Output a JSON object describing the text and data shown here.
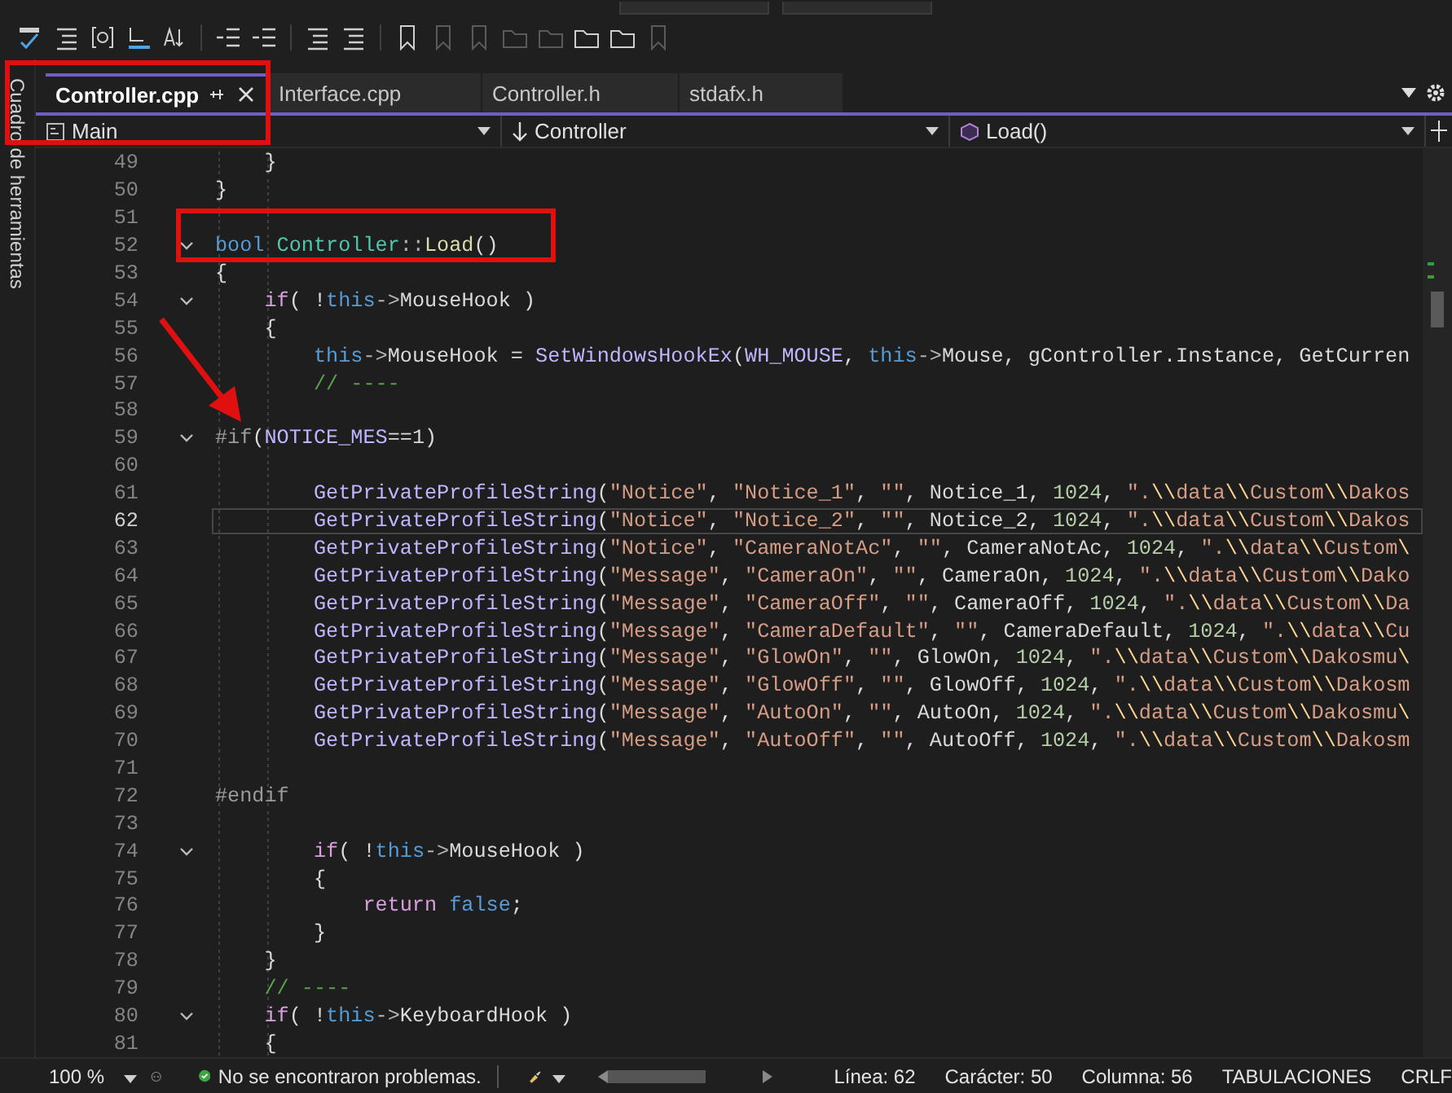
{
  "sidebar": {
    "label": "Cuadro de herramientas"
  },
  "tabs": [
    {
      "label": "Controller.cpp",
      "selected": true
    },
    {
      "label": "Interface.cpp",
      "selected": false
    },
    {
      "label": "Controller.h",
      "selected": false
    },
    {
      "label": "stdafx.h",
      "selected": false
    }
  ],
  "nav": {
    "project": "Main",
    "scope": "Controller",
    "member": "Load()"
  },
  "lines": [
    {
      "number": "49",
      "fold": false,
      "current": false,
      "tokens": [
        {
          "kind": "plain",
          "text": "    }"
        }
      ]
    },
    {
      "number": "50",
      "fold": false,
      "current": false,
      "tokens": [
        {
          "kind": "plain",
          "text": "}"
        }
      ]
    },
    {
      "number": "51",
      "fold": false,
      "current": false
    },
    {
      "number": "52",
      "fold": true,
      "current": false,
      "tokens": [
        {
          "kind": "kw",
          "text": "bool "
        },
        {
          "kind": "type",
          "text": "Controller"
        },
        {
          "kind": "punct",
          "text": "::"
        },
        {
          "kind": "fn",
          "text": "Load"
        },
        {
          "kind": "plain",
          "text": "()"
        }
      ]
    },
    {
      "number": "53",
      "fold": false,
      "current": false,
      "tokens": [
        {
          "kind": "plain",
          "text": "{"
        }
      ]
    },
    {
      "number": "54",
      "fold": true,
      "current": false,
      "tokens": [
        {
          "kind": "ctl",
          "text": "    if"
        },
        {
          "kind": "plain",
          "text": "( !"
        },
        {
          "kind": "kw",
          "text": "this"
        },
        {
          "kind": "punct",
          "text": "->"
        },
        {
          "kind": "plain",
          "text": "MouseHook )"
        }
      ]
    },
    {
      "number": "55",
      "fold": false,
      "current": false,
      "tokens": [
        {
          "kind": "plain",
          "text": "    {"
        }
      ]
    },
    {
      "number": "56",
      "fold": false,
      "current": false,
      "tokens": [
        {
          "kind": "kw",
          "text": "        this"
        },
        {
          "kind": "punct",
          "text": "->"
        },
        {
          "kind": "plain",
          "text": "MouseHook = "
        },
        {
          "kind": "macro",
          "text": "SetWindowsHookEx"
        },
        {
          "kind": "plain",
          "text": "("
        },
        {
          "kind": "macro",
          "text": "WH_MOUSE"
        },
        {
          "kind": "plain",
          "text": ", "
        },
        {
          "kind": "kw",
          "text": "this"
        },
        {
          "kind": "punct",
          "text": "->"
        },
        {
          "kind": "plain",
          "text": "Mouse, gController.Instance, GetCurren"
        }
      ]
    },
    {
      "number": "57",
      "fold": false,
      "current": false,
      "tokens": [
        {
          "kind": "cmt",
          "text": "        // ----"
        }
      ]
    },
    {
      "number": "58",
      "fold": false,
      "current": false
    },
    {
      "number": "59",
      "fold": true,
      "current": false,
      "tokens": [
        {
          "kind": "pre",
          "text": "#if"
        },
        {
          "kind": "plain",
          "text": "("
        },
        {
          "kind": "macro",
          "text": "NOTICE_MES"
        },
        {
          "kind": "plain",
          "text": "==1)"
        }
      ]
    },
    {
      "number": "60",
      "fold": false,
      "current": false
    },
    {
      "number": "61",
      "fold": false,
      "current": false,
      "tokens": [
        {
          "kind": "macro",
          "text": "        GetPrivateProfileString"
        },
        {
          "kind": "plain",
          "text": "("
        },
        {
          "kind": "str",
          "text": "\"Notice\""
        },
        {
          "kind": "plain",
          "text": ", "
        },
        {
          "kind": "str",
          "text": "\"Notice_1\""
        },
        {
          "kind": "plain",
          "text": ", "
        },
        {
          "kind": "str",
          "text": "\"\""
        },
        {
          "kind": "plain",
          "text": ", Notice_1, "
        },
        {
          "kind": "num",
          "text": "1024"
        },
        {
          "kind": "plain",
          "text": ", "
        },
        {
          "kind": "str",
          "text": "\"."
        },
        {
          "kind": "esc",
          "text": "\\\\"
        },
        {
          "kind": "str",
          "text": "data"
        },
        {
          "kind": "esc",
          "text": "\\\\"
        },
        {
          "kind": "str",
          "text": "Custom"
        },
        {
          "kind": "esc",
          "text": "\\\\"
        },
        {
          "kind": "str",
          "text": "Dakos"
        }
      ]
    },
    {
      "number": "62",
      "fold": false,
      "current": true,
      "tokens": [
        {
          "kind": "macro",
          "text": "        GetPrivateProfileString"
        },
        {
          "kind": "plain",
          "text": "("
        },
        {
          "kind": "str",
          "text": "\"Notice\""
        },
        {
          "kind": "plain",
          "text": ", "
        },
        {
          "kind": "str",
          "text": "\"Notice_2\""
        },
        {
          "kind": "plain",
          "text": ", "
        },
        {
          "kind": "str",
          "text": "\"\""
        },
        {
          "kind": "plain",
          "text": ", Notice_2, "
        },
        {
          "kind": "num",
          "text": "1024"
        },
        {
          "kind": "plain",
          "text": ", "
        },
        {
          "kind": "str",
          "text": "\"."
        },
        {
          "kind": "esc",
          "text": "\\\\"
        },
        {
          "kind": "str",
          "text": "data"
        },
        {
          "kind": "esc",
          "text": "\\\\"
        },
        {
          "kind": "str",
          "text": "Custom"
        },
        {
          "kind": "esc",
          "text": "\\\\"
        },
        {
          "kind": "str",
          "text": "Dakos"
        }
      ]
    },
    {
      "number": "63",
      "fold": false,
      "current": false,
      "tokens": [
        {
          "kind": "macro",
          "text": "        GetPrivateProfileString"
        },
        {
          "kind": "plain",
          "text": "("
        },
        {
          "kind": "str",
          "text": "\"Notice\""
        },
        {
          "kind": "plain",
          "text": ", "
        },
        {
          "kind": "str",
          "text": "\"CameraNotAc\""
        },
        {
          "kind": "plain",
          "text": ", "
        },
        {
          "kind": "str",
          "text": "\"\""
        },
        {
          "kind": "plain",
          "text": ", CameraNotAc, "
        },
        {
          "kind": "num",
          "text": "1024"
        },
        {
          "kind": "plain",
          "text": ", "
        },
        {
          "kind": "str",
          "text": "\"."
        },
        {
          "kind": "esc",
          "text": "\\\\"
        },
        {
          "kind": "str",
          "text": "data"
        },
        {
          "kind": "esc",
          "text": "\\\\"
        },
        {
          "kind": "str",
          "text": "Custom"
        },
        {
          "kind": "esc",
          "text": "\\"
        }
      ]
    },
    {
      "number": "64",
      "fold": false,
      "current": false,
      "tokens": [
        {
          "kind": "macro",
          "text": "        GetPrivateProfileString"
        },
        {
          "kind": "plain",
          "text": "("
        },
        {
          "kind": "str",
          "text": "\"Message\""
        },
        {
          "kind": "plain",
          "text": ", "
        },
        {
          "kind": "str",
          "text": "\"CameraOn\""
        },
        {
          "kind": "plain",
          "text": ", "
        },
        {
          "kind": "str",
          "text": "\"\""
        },
        {
          "kind": "plain",
          "text": ", CameraOn, "
        },
        {
          "kind": "num",
          "text": "1024"
        },
        {
          "kind": "plain",
          "text": ", "
        },
        {
          "kind": "str",
          "text": "\"."
        },
        {
          "kind": "esc",
          "text": "\\\\"
        },
        {
          "kind": "str",
          "text": "data"
        },
        {
          "kind": "esc",
          "text": "\\\\"
        },
        {
          "kind": "str",
          "text": "Custom"
        },
        {
          "kind": "esc",
          "text": "\\\\"
        },
        {
          "kind": "str",
          "text": "Dako"
        }
      ]
    },
    {
      "number": "65",
      "fold": false,
      "current": false,
      "tokens": [
        {
          "kind": "macro",
          "text": "        GetPrivateProfileString"
        },
        {
          "kind": "plain",
          "text": "("
        },
        {
          "kind": "str",
          "text": "\"Message\""
        },
        {
          "kind": "plain",
          "text": ", "
        },
        {
          "kind": "str",
          "text": "\"CameraOff\""
        },
        {
          "kind": "plain",
          "text": ", "
        },
        {
          "kind": "str",
          "text": "\"\""
        },
        {
          "kind": "plain",
          "text": ", CameraOff, "
        },
        {
          "kind": "num",
          "text": "1024"
        },
        {
          "kind": "plain",
          "text": ", "
        },
        {
          "kind": "str",
          "text": "\"."
        },
        {
          "kind": "esc",
          "text": "\\\\"
        },
        {
          "kind": "str",
          "text": "data"
        },
        {
          "kind": "esc",
          "text": "\\\\"
        },
        {
          "kind": "str",
          "text": "Custom"
        },
        {
          "kind": "esc",
          "text": "\\\\"
        },
        {
          "kind": "str",
          "text": "Da"
        }
      ]
    },
    {
      "number": "66",
      "fold": false,
      "current": false,
      "tokens": [
        {
          "kind": "macro",
          "text": "        GetPrivateProfileString"
        },
        {
          "kind": "plain",
          "text": "("
        },
        {
          "kind": "str",
          "text": "\"Message\""
        },
        {
          "kind": "plain",
          "text": ", "
        },
        {
          "kind": "str",
          "text": "\"CameraDefault\""
        },
        {
          "kind": "plain",
          "text": ", "
        },
        {
          "kind": "str",
          "text": "\"\""
        },
        {
          "kind": "plain",
          "text": ", CameraDefault, "
        },
        {
          "kind": "num",
          "text": "1024"
        },
        {
          "kind": "plain",
          "text": ", "
        },
        {
          "kind": "str",
          "text": "\"."
        },
        {
          "kind": "esc",
          "text": "\\\\"
        },
        {
          "kind": "str",
          "text": "data"
        },
        {
          "kind": "esc",
          "text": "\\\\"
        },
        {
          "kind": "str",
          "text": "Cu"
        }
      ]
    },
    {
      "number": "67",
      "fold": false,
      "current": false,
      "tokens": [
        {
          "kind": "macro",
          "text": "        GetPrivateProfileString"
        },
        {
          "kind": "plain",
          "text": "("
        },
        {
          "kind": "str",
          "text": "\"Message\""
        },
        {
          "kind": "plain",
          "text": ", "
        },
        {
          "kind": "str",
          "text": "\"GlowOn\""
        },
        {
          "kind": "plain",
          "text": ", "
        },
        {
          "kind": "str",
          "text": "\"\""
        },
        {
          "kind": "plain",
          "text": ", GlowOn, "
        },
        {
          "kind": "num",
          "text": "1024"
        },
        {
          "kind": "plain",
          "text": ", "
        },
        {
          "kind": "str",
          "text": "\"."
        },
        {
          "kind": "esc",
          "text": "\\\\"
        },
        {
          "kind": "str",
          "text": "data"
        },
        {
          "kind": "esc",
          "text": "\\\\"
        },
        {
          "kind": "str",
          "text": "Custom"
        },
        {
          "kind": "esc",
          "text": "\\\\"
        },
        {
          "kind": "str",
          "text": "Dakosmu"
        },
        {
          "kind": "esc",
          "text": "\\"
        }
      ]
    },
    {
      "number": "68",
      "fold": false,
      "current": false,
      "tokens": [
        {
          "kind": "macro",
          "text": "        GetPrivateProfileString"
        },
        {
          "kind": "plain",
          "text": "("
        },
        {
          "kind": "str",
          "text": "\"Message\""
        },
        {
          "kind": "plain",
          "text": ", "
        },
        {
          "kind": "str",
          "text": "\"GlowOff\""
        },
        {
          "kind": "plain",
          "text": ", "
        },
        {
          "kind": "str",
          "text": "\"\""
        },
        {
          "kind": "plain",
          "text": ", GlowOff, "
        },
        {
          "kind": "num",
          "text": "1024"
        },
        {
          "kind": "plain",
          "text": ", "
        },
        {
          "kind": "str",
          "text": "\"."
        },
        {
          "kind": "esc",
          "text": "\\\\"
        },
        {
          "kind": "str",
          "text": "data"
        },
        {
          "kind": "esc",
          "text": "\\\\"
        },
        {
          "kind": "str",
          "text": "Custom"
        },
        {
          "kind": "esc",
          "text": "\\\\"
        },
        {
          "kind": "str",
          "text": "Dakosm"
        }
      ]
    },
    {
      "number": "69",
      "fold": false,
      "current": false,
      "tokens": [
        {
          "kind": "macro",
          "text": "        GetPrivateProfileString"
        },
        {
          "kind": "plain",
          "text": "("
        },
        {
          "kind": "str",
          "text": "\"Message\""
        },
        {
          "kind": "plain",
          "text": ", "
        },
        {
          "kind": "str",
          "text": "\"AutoOn\""
        },
        {
          "kind": "plain",
          "text": ", "
        },
        {
          "kind": "str",
          "text": "\"\""
        },
        {
          "kind": "plain",
          "text": ", AutoOn, "
        },
        {
          "kind": "num",
          "text": "1024"
        },
        {
          "kind": "plain",
          "text": ", "
        },
        {
          "kind": "str",
          "text": "\"."
        },
        {
          "kind": "esc",
          "text": "\\\\"
        },
        {
          "kind": "str",
          "text": "data"
        },
        {
          "kind": "esc",
          "text": "\\\\"
        },
        {
          "kind": "str",
          "text": "Custom"
        },
        {
          "kind": "esc",
          "text": "\\\\"
        },
        {
          "kind": "str",
          "text": "Dakosmu"
        },
        {
          "kind": "esc",
          "text": "\\"
        }
      ]
    },
    {
      "number": "70",
      "fold": false,
      "current": false,
      "tokens": [
        {
          "kind": "macro",
          "text": "        GetPrivateProfileString"
        },
        {
          "kind": "plain",
          "text": "("
        },
        {
          "kind": "str",
          "text": "\"Message\""
        },
        {
          "kind": "plain",
          "text": ", "
        },
        {
          "kind": "str",
          "text": "\"AutoOff\""
        },
        {
          "kind": "plain",
          "text": ", "
        },
        {
          "kind": "str",
          "text": "\"\""
        },
        {
          "kind": "plain",
          "text": ", AutoOff, "
        },
        {
          "kind": "num",
          "text": "1024"
        },
        {
          "kind": "plain",
          "text": ", "
        },
        {
          "kind": "str",
          "text": "\"."
        },
        {
          "kind": "esc",
          "text": "\\\\"
        },
        {
          "kind": "str",
          "text": "data"
        },
        {
          "kind": "esc",
          "text": "\\\\"
        },
        {
          "kind": "str",
          "text": "Custom"
        },
        {
          "kind": "esc",
          "text": "\\\\"
        },
        {
          "kind": "str",
          "text": "Dakosm"
        }
      ]
    },
    {
      "number": "71",
      "fold": false,
      "current": false
    },
    {
      "number": "72",
      "fold": false,
      "current": false,
      "tokens": [
        {
          "kind": "pre",
          "text": "#endif"
        }
      ]
    },
    {
      "number": "73",
      "fold": false,
      "current": false
    },
    {
      "number": "74",
      "fold": true,
      "current": false,
      "tokens": [
        {
          "kind": "ctl",
          "text": "        if"
        },
        {
          "kind": "plain",
          "text": "( !"
        },
        {
          "kind": "kw",
          "text": "this"
        },
        {
          "kind": "punct",
          "text": "->"
        },
        {
          "kind": "plain",
          "text": "MouseHook )"
        }
      ]
    },
    {
      "number": "75",
      "fold": false,
      "current": false,
      "tokens": [
        {
          "kind": "plain",
          "text": "        {"
        }
      ]
    },
    {
      "number": "76",
      "fold": false,
      "current": false,
      "tokens": [
        {
          "kind": "ctl",
          "text": "            return "
        },
        {
          "kind": "kw",
          "text": "false"
        },
        {
          "kind": "plain",
          "text": ";"
        }
      ]
    },
    {
      "number": "77",
      "fold": false,
      "current": false,
      "tokens": [
        {
          "kind": "plain",
          "text": "        }"
        }
      ]
    },
    {
      "number": "78",
      "fold": false,
      "current": false,
      "tokens": [
        {
          "kind": "plain",
          "text": "    }"
        }
      ]
    },
    {
      "number": "79",
      "fold": false,
      "current": false,
      "tokens": [
        {
          "kind": "cmt",
          "text": "    // ----"
        }
      ]
    },
    {
      "number": "80",
      "fold": true,
      "current": false,
      "tokens": [
        {
          "kind": "ctl",
          "text": "    if"
        },
        {
          "kind": "plain",
          "text": "( !"
        },
        {
          "kind": "kw",
          "text": "this"
        },
        {
          "kind": "punct",
          "text": "->"
        },
        {
          "kind": "plain",
          "text": "KeyboardHook )"
        }
      ]
    },
    {
      "number": "81",
      "fold": false,
      "current": false,
      "tokens": [
        {
          "kind": "plain",
          "text": "    {"
        }
      ]
    }
  ],
  "status_bar": {
    "zoom": "100 %",
    "issues": "No se encontraron problemas.",
    "line": "Línea: 62",
    "char": "Carácter: 50",
    "column": "Columna: 56",
    "indent": "TABULACIONES",
    "eol": "CRLF"
  }
}
